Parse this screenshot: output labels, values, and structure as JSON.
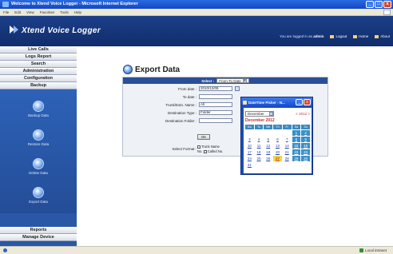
{
  "browser": {
    "title": "Welcome to Xtend Voice Logger - Microsoft Internet Explorer",
    "menu": [
      "File",
      "Edit",
      "View",
      "Favorites",
      "Tools",
      "Help"
    ],
    "status_zone": "Local intranet",
    "window_buttons": {
      "minimize": "_",
      "maximize": "□",
      "close": "x"
    }
  },
  "app": {
    "title": "Xtend Voice Logger",
    "logged_in_prefix": "You are logged in as",
    "user": "admin",
    "links": [
      "Logout",
      "Home",
      "About"
    ]
  },
  "sidebar": {
    "nav_top": [
      "Live Calls",
      "Logs Report",
      "Search",
      "Administration",
      "Configuration",
      "Backup"
    ],
    "icons": [
      "Backup Data",
      "Restore Data",
      "Delete Data",
      "Export Data"
    ],
    "nav_bottom": [
      "Reports",
      "Manage Device"
    ]
  },
  "export": {
    "title": "Export Data",
    "select_label": "Select :",
    "select_value": "From-To Date",
    "from_label": "From date :",
    "from_value": "2010/12/08",
    "to_label": "To date :",
    "to_value": "",
    "trunk_label": "Trunk/Extn. Name :",
    "trunk_value": "All",
    "dest_type_label": "Destination Type :",
    "dest_type_value": "Folder",
    "dest_folder_label": "Destination Folder :",
    "dest_folder_value": "",
    "ok_label": "OK",
    "format_label": "Select Format :",
    "format_opt1": "Trunk Name",
    "format_opt1_suffix": "",
    "format_no": "No.",
    "format_opt2": "Called No."
  },
  "picker": {
    "title": "DateTime Picker - N...",
    "month": "December",
    "year": "2012",
    "header": "December 2012",
    "year_prev": "<",
    "year_next": ">",
    "dow": [
      "Mo",
      "Tu",
      "We",
      "Th",
      "Fr",
      "Sa",
      "Su"
    ],
    "weeks": [
      [
        "",
        "",
        "",
        "",
        "",
        "1",
        "2"
      ],
      [
        "3",
        "4",
        "5",
        "6",
        "7",
        "8",
        "9"
      ],
      [
        "10",
        "11",
        "12",
        "13",
        "14",
        "15",
        "16"
      ],
      [
        "17",
        "18",
        "19",
        "20",
        "21",
        "22",
        "23"
      ],
      [
        "24",
        "25",
        "26",
        "27",
        "28",
        "29",
        "30"
      ],
      [
        "31",
        "",
        "",
        "",
        "",
        "",
        ""
      ]
    ],
    "today": "27"
  }
}
